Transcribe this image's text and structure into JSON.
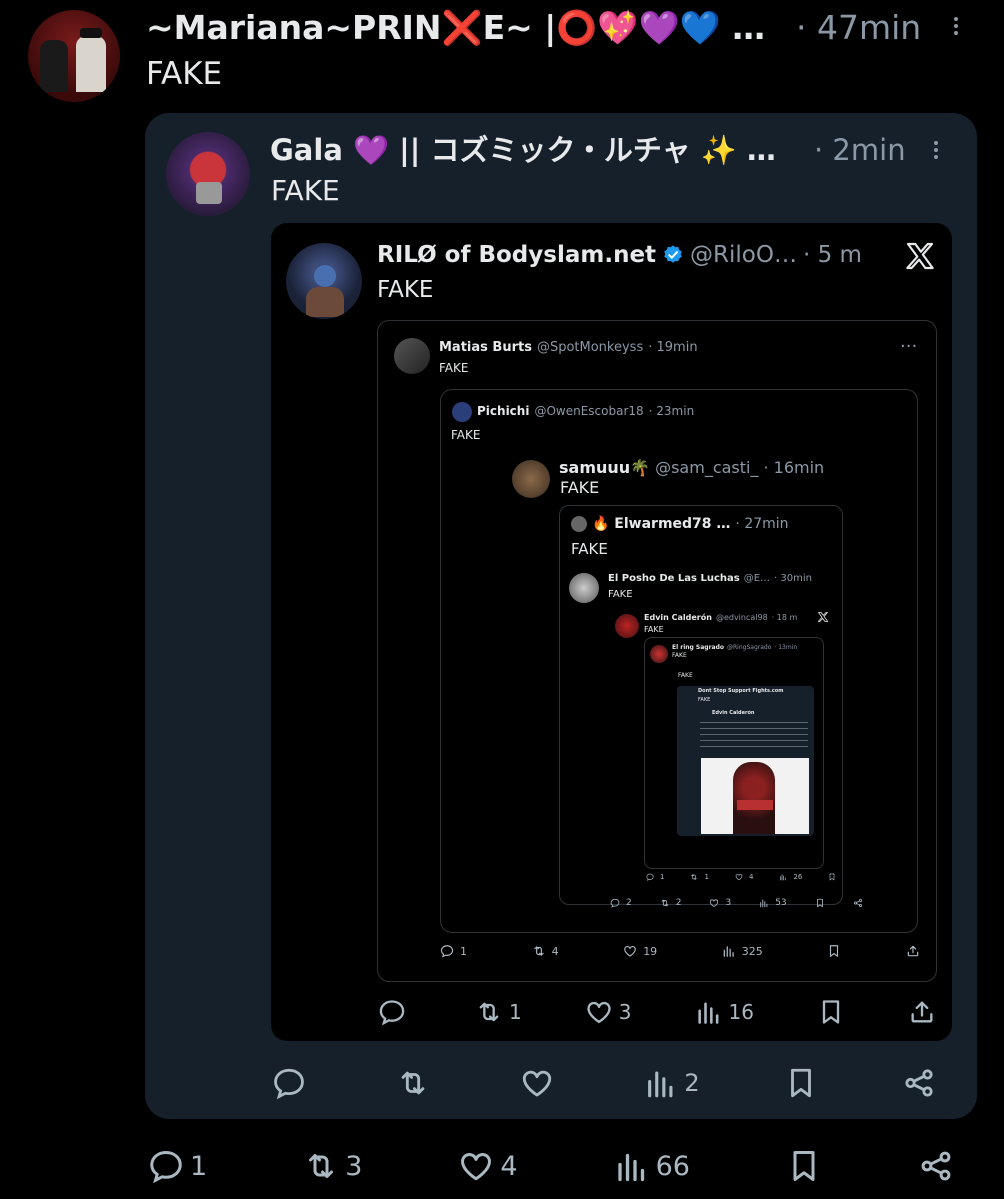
{
  "tweet1": {
    "name": "~Mariana~PRIN❌E~ |⭕💖💜💙 …",
    "time": "· 47min",
    "text": "FAKE",
    "actions": {
      "reply": "1",
      "retweet": "3",
      "like": "4",
      "views": "66"
    }
  },
  "tweet2": {
    "name": "Gala 💜 || コズミック・ルチャ ✨ …",
    "time": "· 2min",
    "text": "FAKE",
    "actions": {
      "reply": "",
      "retweet": "",
      "like": "",
      "views": "2"
    }
  },
  "tweet3": {
    "name": "RILØ of Bodyslam.net",
    "handle": "@RiloO…",
    "time": "· 5 m",
    "text": "FAKE",
    "actions": {
      "reply": "",
      "retweet": "1",
      "like": "3",
      "views": "16"
    }
  },
  "tweet4": {
    "name": "Matias Burts",
    "handle": "@SpotMonkeyss",
    "time": "· 19min",
    "text": "FAKE",
    "actions": {
      "reply": "1",
      "retweet": "4",
      "like": "19",
      "views": "325"
    }
  },
  "tweet5": {
    "name": "Pichichi",
    "handle": "@OwenEscobar18",
    "time": "· 23min",
    "text": "FAKE"
  },
  "tweet6": {
    "name": "samuuu🌴",
    "handle": "@sam_casti_",
    "time": "· 16min",
    "text": "FAKE",
    "actions": {
      "reply": "2",
      "retweet": "2",
      "like": "3",
      "views": "53"
    }
  },
  "tweet7": {
    "name": "🔥 Elwarmed78 …",
    "time": "· 27min",
    "text": "FAKE"
  },
  "tweet8": {
    "name": "El Posho De Las Luchas",
    "handle": "@E…",
    "time": "· 30min",
    "text": "FAKE",
    "actions": {
      "reply": "1",
      "retweet": "1",
      "like": "4",
      "views": "26"
    }
  },
  "tweet9": {
    "name": "Edvin Calderón",
    "handle": "@edvincal98",
    "time": "· 18 m",
    "text": "FAKE"
  },
  "tweet10": {
    "name": "El ring Sagrado",
    "handle": "@RingSagrado",
    "time": "· 13min",
    "text": "FAKE"
  },
  "tweet11": {
    "text": "FAKE"
  },
  "tweet12": {
    "name": "Dont Stop Support Fights.com",
    "text": "FAKE"
  },
  "tweet13": {
    "name": "Edvin Calderón"
  },
  "icons": {
    "reply": "reply-icon",
    "retweet": "retweet-icon",
    "like": "heart-icon",
    "views": "views-icon",
    "bookmark": "bookmark-icon",
    "share": "share-icon",
    "verified": "verified-badge-icon",
    "x_logo": "x-logo-icon",
    "more": "more-vertical-icon"
  },
  "colors": {
    "background": "#000000",
    "card": "#15202b",
    "accent_verified": "#1d9bf0",
    "muted": "#8b98a5"
  }
}
